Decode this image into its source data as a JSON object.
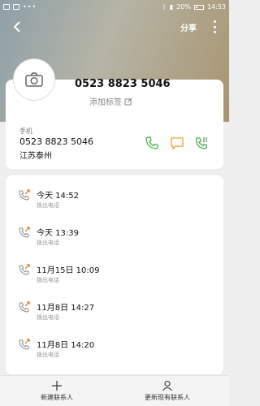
{
  "status_bar": {
    "battery": "20%",
    "time": "14:53"
  },
  "topbar": {
    "share_label": "分享"
  },
  "contact": {
    "number": "0523 8823 5046",
    "add_tag_label": "添加标签"
  },
  "phone": {
    "label": "手机",
    "number": "0523 8823 5046",
    "location": "江苏泰州"
  },
  "call_log": [
    {
      "time": "今天 14:52",
      "type": "拨出电话"
    },
    {
      "time": "今天 13:39",
      "type": "拨出电话"
    },
    {
      "time": "11月15日 10:09",
      "type": "拨出电话"
    },
    {
      "time": "11月8日 14:27",
      "type": "拨出电话"
    },
    {
      "time": "11月8日 14:20",
      "type": "拨出电话"
    }
  ],
  "bottom": {
    "new_contact": "新建联系人",
    "update_contact": "更新现有联系人"
  },
  "colors": {
    "accent_green": "#4caf50",
    "message_orange": "#f0a030",
    "call_icon_orange": "#e07a2a"
  }
}
